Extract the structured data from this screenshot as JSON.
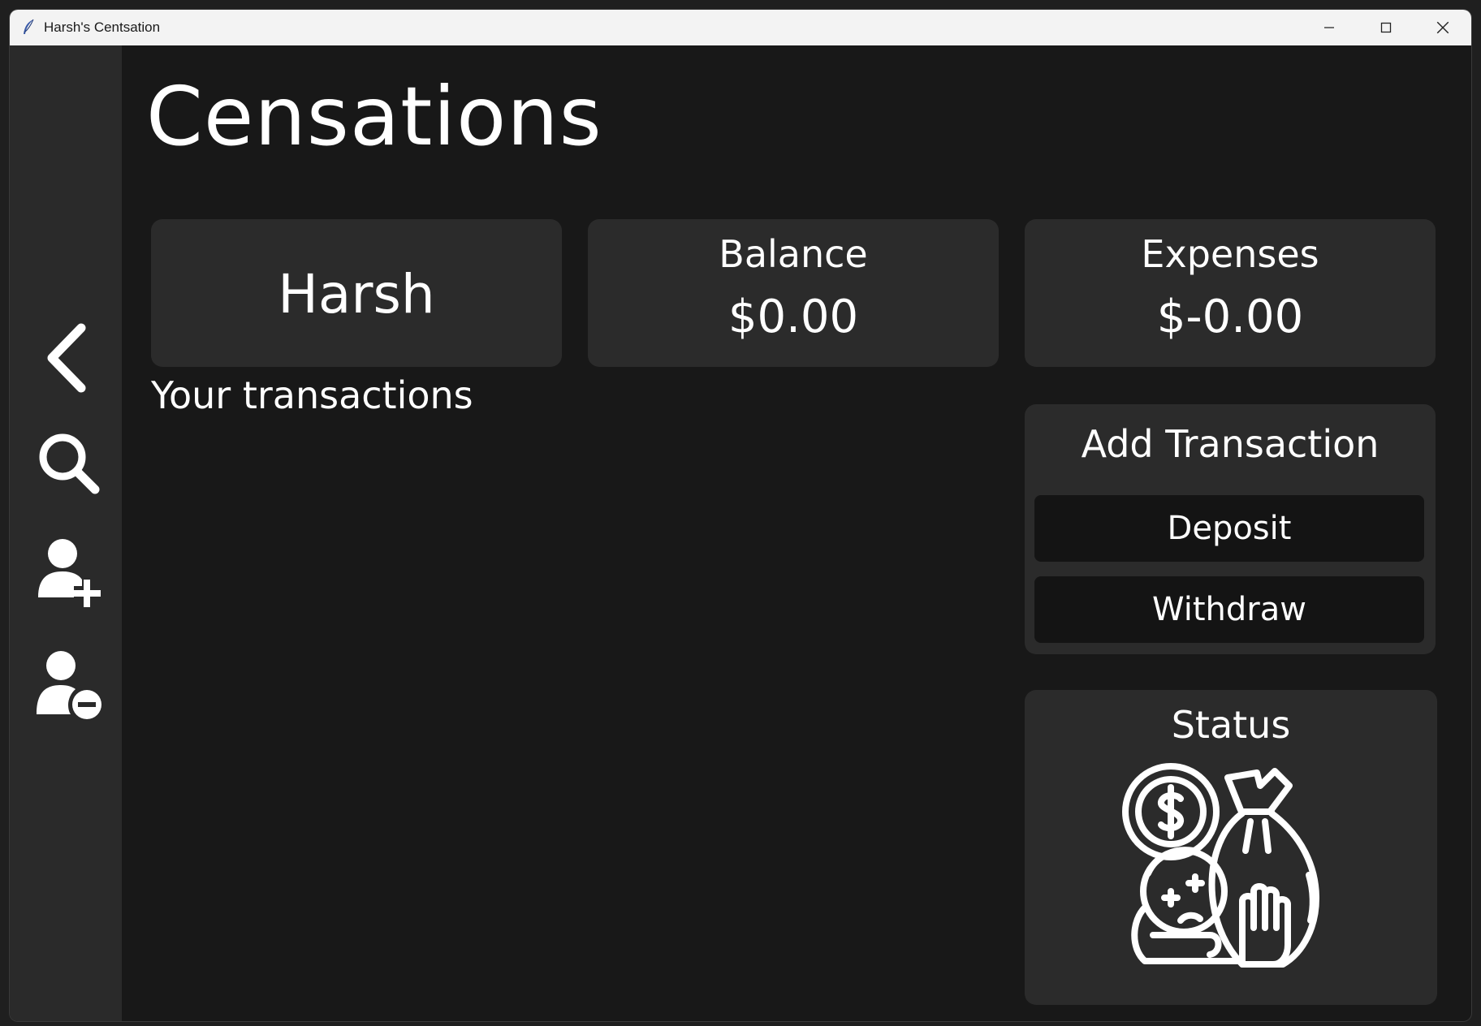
{
  "window": {
    "title": "Harsh's Centsation",
    "controls": [
      "minimize-icon",
      "maximize-icon",
      "close-icon"
    ]
  },
  "sidebar": {
    "items": [
      {
        "name": "back",
        "icon": "chevron-left-icon"
      },
      {
        "name": "search",
        "icon": "search-icon"
      },
      {
        "name": "add-user",
        "icon": "user-plus-icon"
      },
      {
        "name": "remove-user",
        "icon": "user-minus-icon"
      }
    ]
  },
  "header": {
    "title": "Censations"
  },
  "user_card": {
    "name": "Harsh"
  },
  "balance_card": {
    "label": "Balance",
    "value": "$0.00"
  },
  "expenses_card": {
    "label": "Expenses",
    "value": "$-0.00"
  },
  "transactions": {
    "label": "Your transactions",
    "items": []
  },
  "add_transaction": {
    "title": "Add Transaction",
    "deposit_label": "Deposit",
    "withdraw_label": "Withdraw"
  },
  "status": {
    "title": "Status",
    "icon": "broke-person-money-bag-icon"
  },
  "colors": {
    "background": "#181818",
    "sidebar": "#2a2a2a",
    "card": "#2b2b2b",
    "button": "#141414",
    "text": "#ffffff"
  }
}
